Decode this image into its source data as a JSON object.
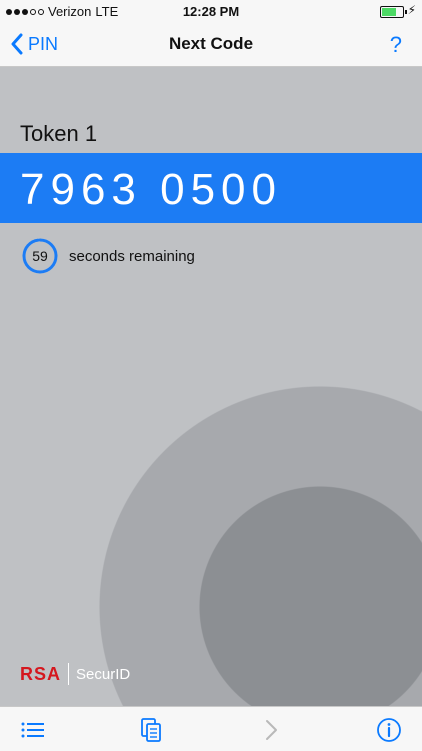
{
  "status_bar": {
    "carrier": "Verizon",
    "network": "LTE",
    "time": "12:28 PM"
  },
  "nav": {
    "back_label": "PIN",
    "title": "Next Code",
    "help_label": "?"
  },
  "token": {
    "name": "Token 1",
    "code": "7963 0500",
    "seconds": "59",
    "remaining_label": "seconds remaining",
    "timer_fraction": 0.98
  },
  "branding": {
    "brand": "RSA",
    "product": "SecurID"
  },
  "colors": {
    "accent": "#0a7aff",
    "code_bar": "#1c7cf4",
    "brand_red": "#d5171e"
  },
  "toolbar": {
    "icons": [
      "list-icon",
      "copy-icon",
      "chevron-right-icon",
      "info-icon"
    ]
  }
}
